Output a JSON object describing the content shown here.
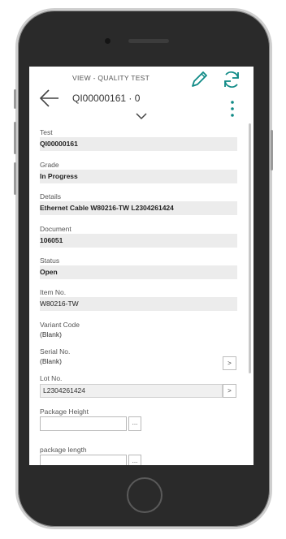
{
  "header": {
    "mode": "VIEW - QUALITY TEST",
    "record": "QI00000161 · 0"
  },
  "fields": [
    {
      "label": "Test",
      "value": "QI00000161"
    },
    {
      "label": "Grade",
      "value": "In Progress"
    },
    {
      "label": "Details",
      "value": "Ethernet Cable W80216-TW L2304261424"
    },
    {
      "label": "Document",
      "value": "106051"
    },
    {
      "label": "Status",
      "value": "Open"
    }
  ],
  "item_no": {
    "label": "Item No.",
    "value": "W80216-TW"
  },
  "variant_code": {
    "label": "Variant Code",
    "value": "(Blank)"
  },
  "serial_no": {
    "label": "Serial No.",
    "value": "(Blank)",
    "button": ">"
  },
  "lot_no": {
    "label": "Lot No.",
    "value": "L2304261424",
    "button": ">"
  },
  "package_height": {
    "label": "Package Height",
    "value": "",
    "button": "..."
  },
  "package_length": {
    "label": "package length",
    "value": "",
    "button": "..."
  },
  "icons": {
    "back": "back-arrow-icon",
    "edit": "pencil-icon",
    "refresh": "refresh-icon",
    "more": "vertical-ellipsis-icon",
    "expand": "chevron-down-icon"
  },
  "colors": {
    "accent": "#0f8a86",
    "field_bg": "#ececec"
  }
}
